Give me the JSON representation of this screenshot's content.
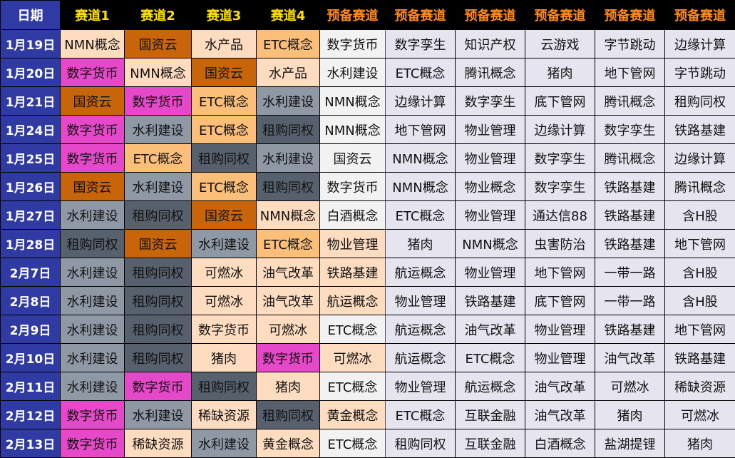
{
  "colors": {
    "date_header_bg": "#2f3ba3",
    "track_header_text": "#ffe000",
    "reserve_header_text": "#ff8a1a",
    "header_bg": "#000000",
    "reserve_cell_bg": "#e6e4ee",
    "cell_fills": {
      "peach": "#fddcbf",
      "orange": "#c8640a",
      "light_orange": "#fcbf7a",
      "magenta": "#e548c8",
      "slate": "#8f99a6",
      "dark_slate": "#57616e",
      "pale": "#f2f2f2"
    }
  },
  "table": {
    "headers": [
      "日期",
      "赛道1",
      "赛道2",
      "赛道3",
      "赛道4",
      "预备赛道",
      "预备赛道",
      "预备赛道",
      "预备赛道",
      "预备赛道",
      "预备赛道"
    ],
    "rows": [
      {
        "date": "1月19日",
        "cells": [
          "NMN概念",
          "国资云",
          "水产品",
          "ETC概念",
          "数字货币",
          "数字孪生",
          "知识产权",
          "云游戏",
          "字节跳动",
          "边缘计算"
        ],
        "fills": [
          "peach",
          "orange",
          "peach",
          "light_orange",
          "pale"
        ]
      },
      {
        "date": "1月20日",
        "cells": [
          "数字货币",
          "NMN概念",
          "国资云",
          "水产品",
          "水利建设",
          "ETC概念",
          "腾讯概念",
          "猪肉",
          "地下管网",
          "字节跳动"
        ],
        "fills": [
          "magenta",
          "peach",
          "orange",
          "peach",
          "pale"
        ]
      },
      {
        "date": "1月21日",
        "cells": [
          "国资云",
          "数字货币",
          "ETC概念",
          "水利建设",
          "NMN概念",
          "边缘计算",
          "数字孪生",
          "底下管网",
          "腾讯概念",
          "租购同权"
        ],
        "fills": [
          "orange",
          "magenta",
          "light_orange",
          "slate",
          "pale"
        ]
      },
      {
        "date": "1月24日",
        "cells": [
          "数字货币",
          "水利建设",
          "ETC概念",
          "租购同权",
          "NMN概念",
          "地下管网",
          "物业管理",
          "边缘计算",
          "数字孪生",
          "铁路基建"
        ],
        "fills": [
          "magenta",
          "slate",
          "light_orange",
          "dark_slate",
          "pale"
        ]
      },
      {
        "date": "1月25日",
        "cells": [
          "数字货币",
          "ETC概念",
          "租购同权",
          "水利建设",
          "国资云",
          "NMN概念",
          "物业管理",
          "数字孪生",
          "腾讯概念",
          "边缘计算"
        ],
        "fills": [
          "magenta",
          "light_orange",
          "dark_slate",
          "slate",
          "pale"
        ]
      },
      {
        "date": "1月26日",
        "cells": [
          "国资云",
          "水利建设",
          "ETC概念",
          "租购同权",
          "数字货币",
          "NMN概念",
          "物业概念",
          "数字孪生",
          "铁路基建",
          "腾讯概念"
        ],
        "fills": [
          "orange",
          "slate",
          "light_orange",
          "dark_slate",
          "pale"
        ]
      },
      {
        "date": "1月27日",
        "cells": [
          "水利建设",
          "租购同权",
          "国资云",
          "NMN概念",
          "白酒概念",
          "ETC概念",
          "物业管理",
          "通达信88",
          "铁路基建",
          "含H股"
        ],
        "fills": [
          "slate",
          "dark_slate",
          "orange",
          "peach",
          "pale"
        ]
      },
      {
        "date": "1月28日",
        "cells": [
          "租购同权",
          "国资云",
          "水利建设",
          "ETC概念",
          "物业管理",
          "猪肉",
          "NMN概念",
          "虫害防治",
          "铁路基建",
          "地下管网"
        ],
        "fills": [
          "dark_slate",
          "orange",
          "slate",
          "light_orange",
          "peach"
        ]
      },
      {
        "date": "2月7日",
        "cells": [
          "水利建设",
          "租购同权",
          "可燃冰",
          "油气改革",
          "铁路基建",
          "航运概念",
          "物业管理",
          "地下管网",
          "一带一路",
          "含H股"
        ],
        "fills": [
          "slate",
          "dark_slate",
          "peach",
          "peach",
          "peach"
        ]
      },
      {
        "date": "2月8日",
        "cells": [
          "水利建设",
          "租购同权",
          "可燃冰",
          "油气改革",
          "航运概念",
          "物业管理",
          "铁路基建",
          "底下管网",
          "一带一路",
          "含H股"
        ],
        "fills": [
          "slate",
          "dark_slate",
          "peach",
          "peach",
          "peach"
        ]
      },
      {
        "date": "2月9日",
        "cells": [
          "水利建设",
          "租购同权",
          "数字货币",
          "可燃冰",
          "ETC概念",
          "航运概念",
          "油气改革",
          "物业管理",
          "铁路基建",
          "地下管网"
        ],
        "fills": [
          "slate",
          "dark_slate",
          "peach",
          "peach",
          "pale"
        ]
      },
      {
        "date": "2月10日",
        "cells": [
          "水利建设",
          "租购同权",
          "猪肉",
          "数字货币",
          "可燃冰",
          "航运概念",
          "ETC概念",
          "物业管理",
          "油气改革",
          "铁路基建"
        ],
        "fills": [
          "slate",
          "dark_slate",
          "peach",
          "magenta",
          "peach"
        ]
      },
      {
        "date": "2月11日",
        "cells": [
          "水利建设",
          "数字货币",
          "租购同权",
          "猪肉",
          "ETC概念",
          "物业管理",
          "航运概念",
          "油气改革",
          "可燃冰",
          "稀缺资源"
        ],
        "fills": [
          "slate",
          "magenta",
          "dark_slate",
          "peach",
          "pale"
        ]
      },
      {
        "date": "2月12日",
        "cells": [
          "数字货币",
          "水利建设",
          "稀缺资源",
          "租购同权",
          "黄金概念",
          "ETC概念",
          "互联金融",
          "油气改革",
          "猪肉",
          "可燃冰"
        ],
        "fills": [
          "magenta",
          "slate",
          "peach",
          "dark_slate",
          "peach"
        ]
      },
      {
        "date": "2月13日",
        "cells": [
          "数字货币",
          "稀缺资源",
          "水利建设",
          "黄金概念",
          "ETC概念",
          "租购同权",
          "互联金融",
          "白酒概念",
          "盐湖提锂",
          "猪肉"
        ],
        "fills": [
          "magenta",
          "peach",
          "slate",
          "peach",
          "pale"
        ]
      }
    ]
  }
}
